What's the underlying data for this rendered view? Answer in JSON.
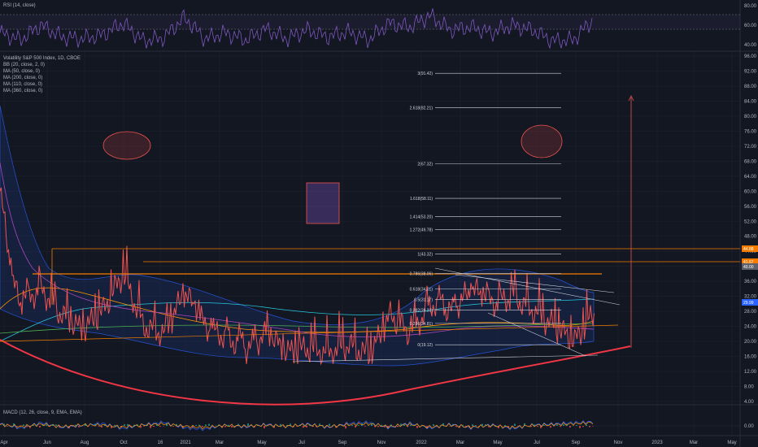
{
  "chart_data": [
    {
      "type": "line",
      "panel": "rsi",
      "title": "RSI (14, close)",
      "y_ticks": [
        "80.00",
        "60.00",
        "40.00"
      ],
      "ylim": [
        35,
        82
      ],
      "series": [
        {
          "name": "RSI",
          "color": "#7e57c2",
          "x": [
            "2020-04",
            "2020-05",
            "2020-06",
            "2020-07",
            "2020-08",
            "2020-09",
            "2020-10",
            "2020-11",
            "2020-12",
            "2021-01",
            "2021-02",
            "2021-03",
            "2021-04",
            "2021-05",
            "2021-06",
            "2021-07",
            "2021-08",
            "2021-09",
            "2021-10",
            "2021-11",
            "2021-12",
            "2022-01",
            "2022-02",
            "2022-03",
            "2022-04",
            "2022-05",
            "2022-06",
            "2022-07",
            "2022-08",
            "2022-09"
          ],
          "values": [
            52,
            45,
            60,
            48,
            46,
            50,
            62,
            44,
            47,
            68,
            46,
            52,
            45,
            56,
            46,
            55,
            48,
            53,
            45,
            62,
            58,
            70,
            55,
            58,
            52,
            60,
            55,
            44,
            45,
            66
          ]
        }
      ]
    },
    {
      "type": "line",
      "panel": "price",
      "title": "Volatility S&P 500 Index, 1D, CBOE",
      "legend": [
        "BB (20, close, 2, 0)",
        "MA (50, close, 0)",
        "MA (200, close, 0)",
        "MA (110, close, 0)",
        "MA (360, close, 0)"
      ],
      "y_ticks": [
        "96.00",
        "92.00",
        "88.00",
        "84.00",
        "80.00",
        "76.00",
        "72.00",
        "68.00",
        "64.00",
        "60.00",
        "56.00",
        "52.00",
        "48.00",
        "44.00",
        "40.00",
        "36.00",
        "32.00",
        "28.00",
        "24.00",
        "20.00",
        "16.00",
        "12.00",
        "8.00",
        "4.00"
      ],
      "ylim": [
        2,
        98
      ],
      "x_ticks": [
        "Apr",
        "Jun",
        "Aug",
        "Oct",
        "16",
        "2021",
        "Mar",
        "May",
        "Jul",
        "Sep",
        "Nov",
        "2022",
        "Mar",
        "May",
        "Jul",
        "Sep",
        "Nov",
        "2023",
        "Mar",
        "May"
      ],
      "series": [
        {
          "name": "VIX",
          "color": "#ef5350",
          "x": [
            "2020-04",
            "2020-05",
            "2020-06",
            "2020-07",
            "2020-08",
            "2020-09",
            "2020-10",
            "2020-11",
            "2020-12",
            "2021-01",
            "2021-02",
            "2021-03",
            "2021-04",
            "2021-05",
            "2021-06",
            "2021-07",
            "2021-08",
            "2021-09",
            "2021-10",
            "2021-11",
            "2021-12",
            "2022-01",
            "2022-02",
            "2022-03",
            "2022-04",
            "2022-05",
            "2022-06",
            "2022-07",
            "2022-08",
            "2022-09"
          ],
          "values": [
            46,
            30,
            34,
            27,
            23,
            28,
            38,
            24,
            22,
            33,
            24,
            21,
            18,
            22,
            17,
            18,
            17,
            19,
            16,
            27,
            22,
            30,
            28,
            34,
            30,
            32,
            28,
            24,
            20,
            28
          ]
        }
      ],
      "fib_levels": [
        {
          "label": "3(91.42)",
          "value": 91.42
        },
        {
          "label": "2.618(82.21)",
          "value": 82.21
        },
        {
          "label": "2(67.32)",
          "value": 67.32
        },
        {
          "label": "1.618(58.11)",
          "value": 58.11
        },
        {
          "label": "1.414(53.20)",
          "value": 53.2
        },
        {
          "label": "1.272(49.78)",
          "value": 49.78
        },
        {
          "label": "1(43.32)",
          "value": 43.32
        },
        {
          "label": "0.786(38.06)",
          "value": 38.06
        },
        {
          "label": "0.618(34.01)",
          "value": 34.01
        },
        {
          "label": "0.5(31.17)",
          "value": 31.17
        },
        {
          "label": "0.382(28.33)",
          "value": 28.33
        },
        {
          "label": "0.236(24.81)",
          "value": 24.81
        },
        {
          "label": "0(19.12)",
          "value": 19.12
        }
      ],
      "horizontal_lines": [
        44.8,
        41.5,
        37.8
      ],
      "price_tags": [
        {
          "label": "44.88",
          "color": "#f57c00"
        },
        {
          "label": "41.67",
          "color": "#f57c00"
        },
        {
          "label": "40.00",
          "color": "#5d606b"
        },
        {
          "label": "29.99",
          "color": "#2962ff"
        }
      ],
      "arrow": {
        "from": 23.5,
        "to": 84.0,
        "color": "#ef5350"
      }
    },
    {
      "type": "line",
      "panel": "macd",
      "title": "MACD (12, 26, close, 9, EMA, EMA)",
      "y_ticks": [
        "0.00"
      ],
      "ylim": [
        -4,
        4
      ],
      "series": [
        {
          "name": "MACD",
          "color": "#2962ff",
          "values": [
            0.5,
            -0.6,
            0.8,
            -0.4,
            0.1,
            0.6,
            -0.7,
            0.3,
            0.9,
            -0.5,
            -0.8,
            0.2,
            -0.3,
            0.4,
            -0.2,
            0.5,
            -0.4,
            0.6,
            0.9,
            -0.5,
            0.7,
            -0.6,
            0.4,
            -0.5,
            0.3,
            -0.7,
            0.2,
            0.5,
            0.8,
            1.0
          ]
        },
        {
          "name": "Signal",
          "color": "#ff9800",
          "values": [
            0.3,
            -0.2,
            0.4,
            -0.2,
            0.2,
            0.2,
            -0.3,
            0.2,
            0.5,
            -0.1,
            -0.4,
            0.1,
            -0.1,
            0.2,
            -0.1,
            0.3,
            -0.2,
            0.3,
            0.5,
            -0.2,
            0.4,
            -0.3,
            0.2,
            -0.3,
            0.1,
            -0.4,
            0.1,
            0.3,
            0.5,
            0.8
          ]
        }
      ]
    }
  ]
}
